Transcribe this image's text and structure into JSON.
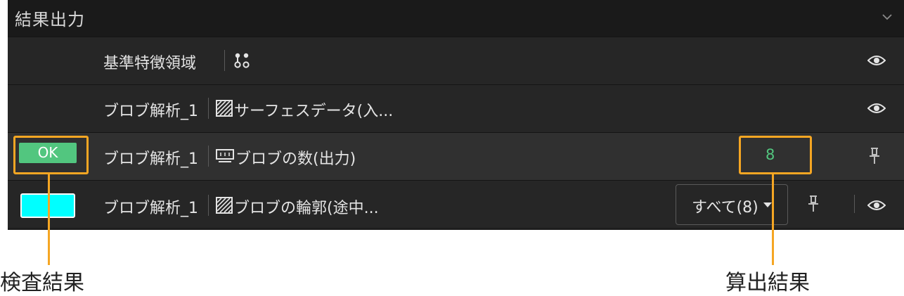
{
  "panel": {
    "title": "結果出力",
    "rows": [
      {
        "source": "基準特徴領域",
        "description": "",
        "icon": "keypoints-icon"
      },
      {
        "source": "ブロブ解析_1",
        "description": "サーフェスデータ(入...",
        "icon": "hatched-image-icon"
      },
      {
        "source": "ブロブ解析_1",
        "description": "ブロブの数(出力)",
        "icon": "number-display-icon",
        "status": "OK",
        "value": "8"
      },
      {
        "source": "ブロブ解析_1",
        "description": "ブロブの輪郭(途中...",
        "icon": "hatched-image-icon",
        "color": "#00ffff",
        "dropdown": "すべて(8)"
      }
    ]
  },
  "annotations": {
    "left": "検査結果",
    "right": "算出結果",
    "color": "#f5a623"
  }
}
